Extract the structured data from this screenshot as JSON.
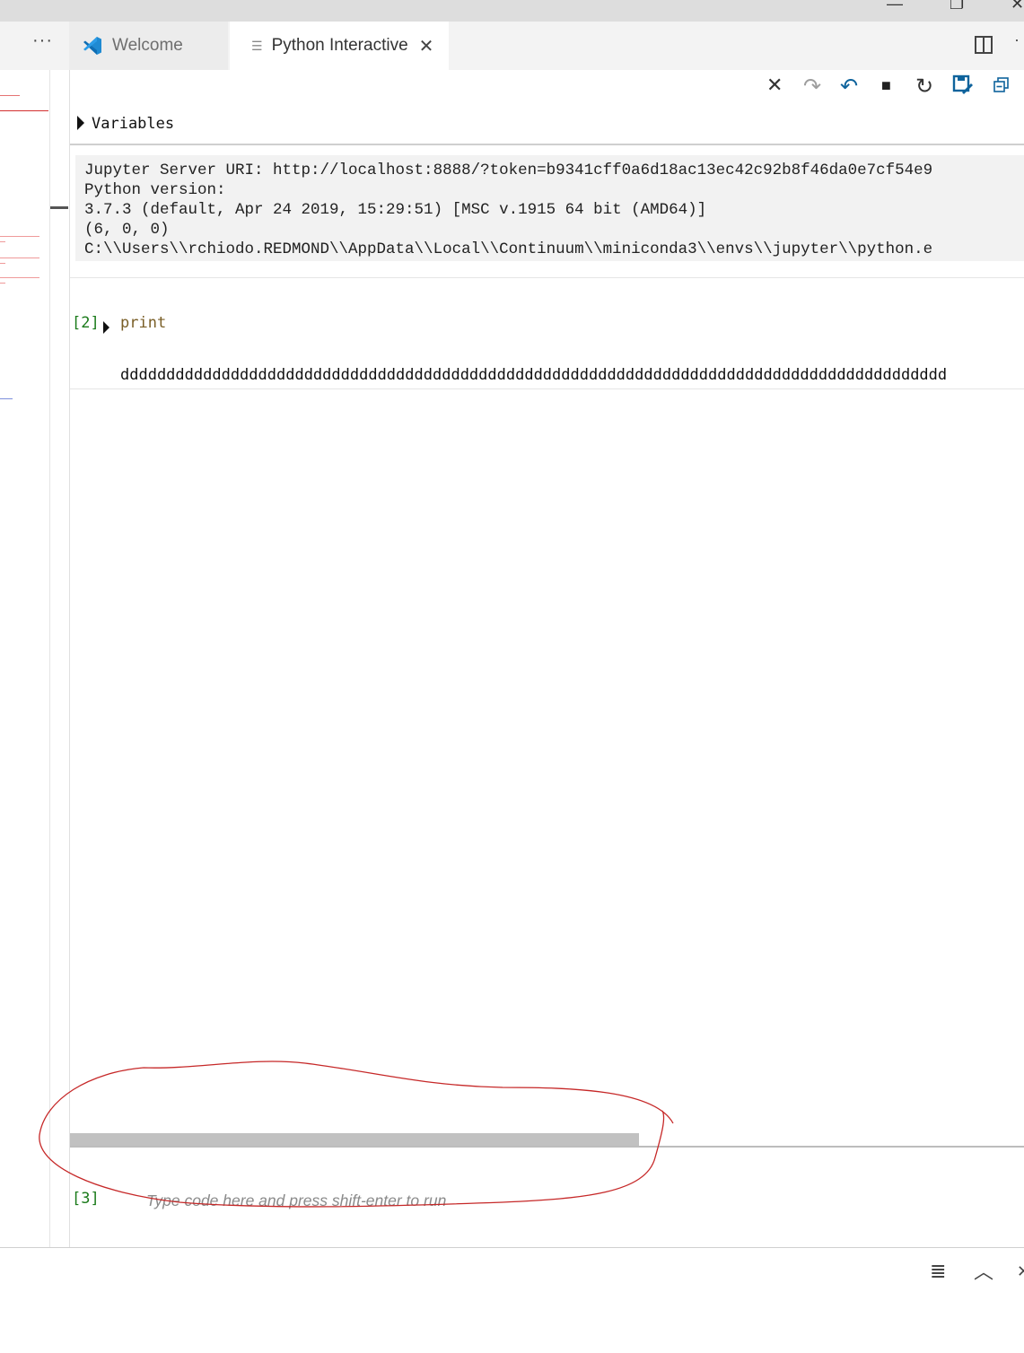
{
  "window": {
    "minimize_glyph": "—",
    "restore_glyph": "❐",
    "close_glyph": "✕"
  },
  "tabs": {
    "more": "···",
    "welcome_label": "Welcome",
    "active_label": "Python Interactive",
    "active_close": "✕",
    "overflow": "·"
  },
  "toolbar": {
    "icons": [
      "clear-all-icon",
      "redo-icon",
      "undo-icon",
      "interrupt-icon",
      "restart-icon",
      "export-icon",
      "collapse-all-icon"
    ],
    "clear_glyph": "✕",
    "redo_glyph": "↷",
    "undo_glyph": "↶",
    "stop_glyph": "■",
    "restart_glyph": "↻",
    "colors": {
      "accent": "#0e639c",
      "muted": "#9e9e9e",
      "normal": "#333333"
    }
  },
  "variables": {
    "label": "Variables"
  },
  "sysinfo": {
    "lines": [
      "Jupyter Server URI: http://localhost:8888/?token=b9341cff0a6d18ac13ec42c92b8f46da0e7cf54e9",
      "Python version:",
      "3.7.3 (default, Apr 24 2019, 15:29:51) [MSC v.1915 64 bit (AMD64)]",
      "(6, 0, 0)",
      "C:\\\\Users\\\\rchiodo.REDMOND\\\\AppData\\\\Local\\\\Continuum\\\\miniconda3\\\\envs\\\\jupyter\\\\python.e"
    ]
  },
  "cell": {
    "count": "[2]",
    "code": "print",
    "output": "dddddddddddddddddddddddddddddddddddddddddddddddddddddddddddddddddddddddddddddddddddddddddd"
  },
  "input": {
    "count": "[3]",
    "placeholder": "Type code here and press shift-enter to run"
  },
  "panel": {
    "clear_glyph": "≣",
    "up_glyph": "︿",
    "close_glyph": "✕"
  }
}
